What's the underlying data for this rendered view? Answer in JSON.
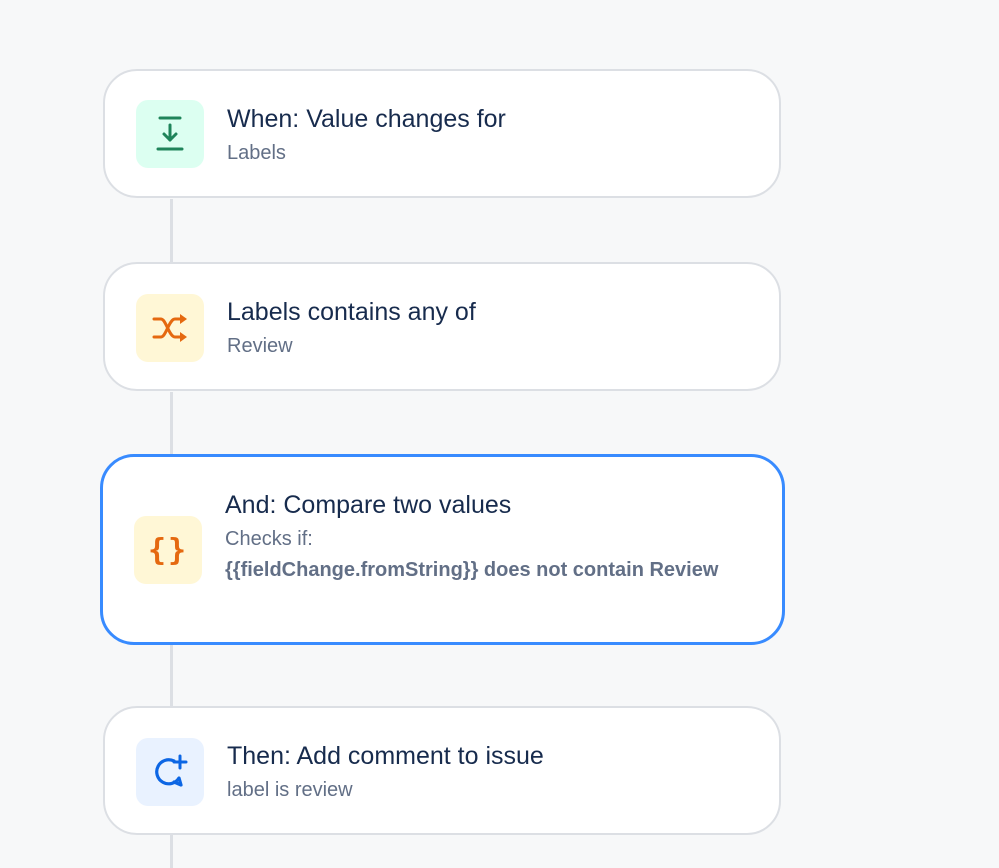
{
  "rules": [
    {
      "title": "When: Value changes for",
      "subtitle": "Labels",
      "icon": "field-value-changed-icon",
      "icon_bg": "#dcfff1",
      "icon_color": "#1f845a"
    },
    {
      "title": "Labels contains any of",
      "subtitle": "Review",
      "icon": "shuffle-branch-icon",
      "icon_bg": "#fff7d6",
      "icon_color": "#e56910"
    },
    {
      "title": "And: Compare two values",
      "subtitle": "Checks if:",
      "detail": "{{fieldChange.fromString}} does not contain Review",
      "icon_glyph": "{}",
      "icon": "curly-braces-icon",
      "icon_bg": "#fff7d6",
      "icon_color": "#e56910",
      "selected": true,
      "selected_border": "#388bff"
    },
    {
      "title": "Then: Add comment to issue",
      "subtitle": "label is review",
      "icon": "add-comment-icon",
      "icon_bg": "#e9f2ff",
      "icon_color": "#0c66e4"
    }
  ]
}
